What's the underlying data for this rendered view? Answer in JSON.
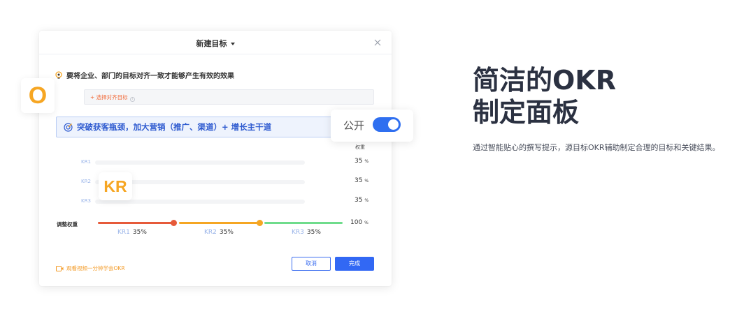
{
  "modal": {
    "title": "新建目标",
    "hint": "要将企业、部门的目标对齐一致才能够产生有效的效果",
    "align_placeholder": "+ 选择对齐目标",
    "objective": "突破获客瓶颈，加大营销（推广、渠道）+ 增长主干道",
    "weight_header": "权重",
    "key_results": [
      {
        "label": "KR1",
        "weight": "35",
        "unit": "%"
      },
      {
        "label": "KR2",
        "weight": "35",
        "unit": "%"
      },
      {
        "label": "KR3",
        "weight": "35",
        "unit": "%"
      }
    ],
    "adjust_label": "调整权重",
    "total": "100",
    "total_unit": "%",
    "weight_segments": [
      {
        "label": "KR1",
        "value": "35%",
        "color": "#e65a3a"
      },
      {
        "label": "KR2",
        "value": "35%",
        "color": "#f5a623"
      },
      {
        "label": "KR3",
        "value": "35%",
        "color": "#6fdc8c"
      }
    ],
    "video_link": "观看视频一分钟学会OKR",
    "cancel_label": "取消",
    "done_label": "完成"
  },
  "callouts": {
    "objective_badge": "O",
    "kr_badge": "KR",
    "public_label": "公开",
    "public_toggle_on": true
  },
  "feature": {
    "headline_line1": "简洁的OKR",
    "headline_line2": "制定面板",
    "description": "通过智能贴心的撰写提示，源目标OKR辅助制定合理的目标和关键结果。"
  },
  "colors": {
    "accent": "#3268f4",
    "orange": "#f6a623",
    "headline": "#2b3141"
  }
}
